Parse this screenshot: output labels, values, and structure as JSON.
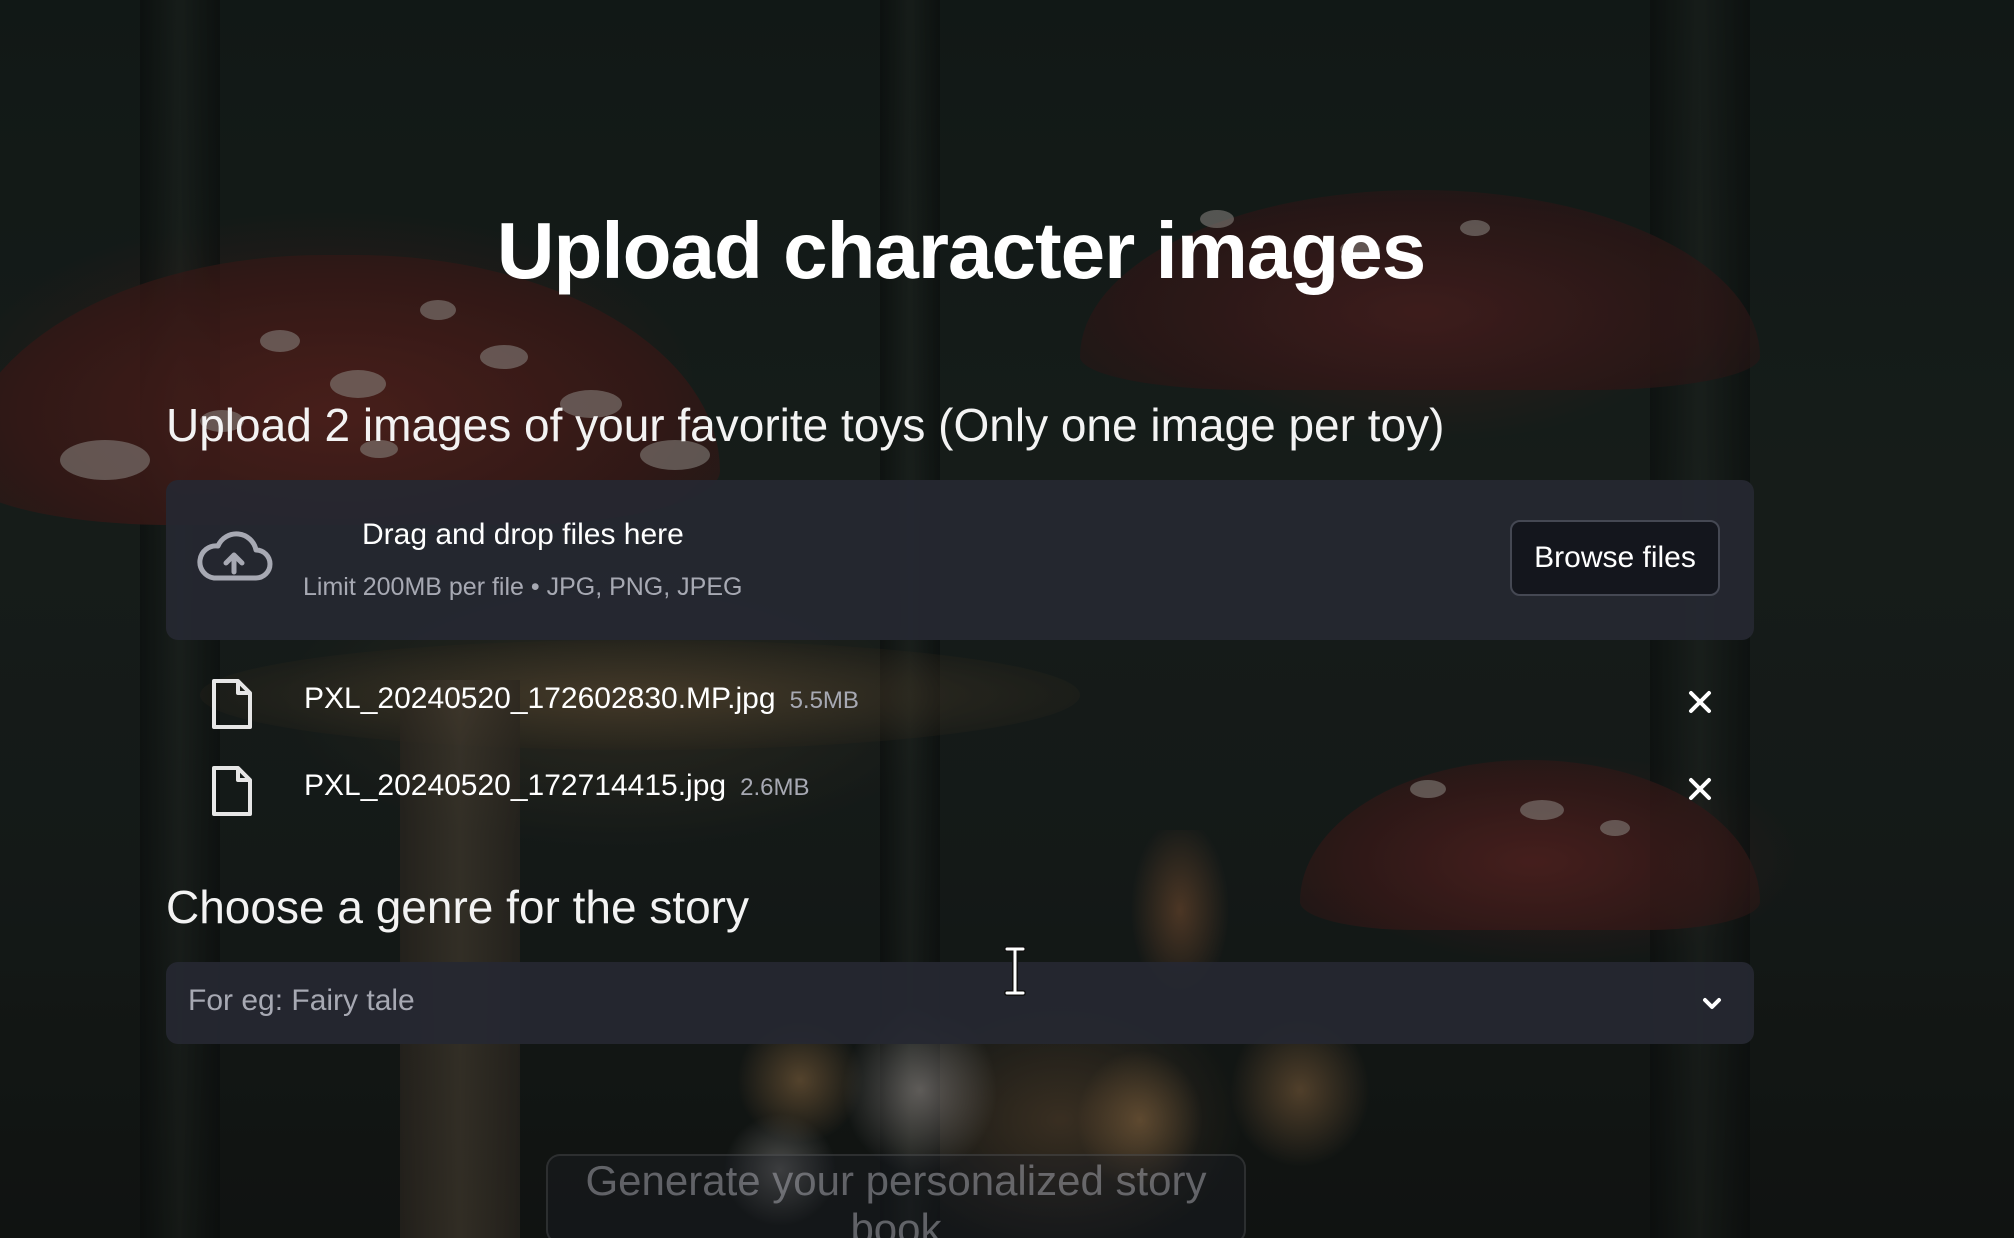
{
  "page": {
    "title": "Upload character images"
  },
  "upload": {
    "label": "Upload 2 images of your favorite toys (Only one image per toy)",
    "dropzone_title": "Drag and drop files here",
    "dropzone_limit": "Limit 200MB per file • JPG, PNG, JPEG",
    "browse_label": "Browse files",
    "files": [
      {
        "name": "PXL_20240520_172602830.MP.jpg",
        "size": "5.5MB"
      },
      {
        "name": "PXL_20240520_172714415.jpg",
        "size": "2.6MB"
      }
    ]
  },
  "genre": {
    "label": "Choose a genre for the story",
    "placeholder": "For eg: Fairy tale"
  },
  "generate": {
    "label": "Generate your personalized story book"
  },
  "colors": {
    "panel": "#262832",
    "text": "#ffffff",
    "muted": "#a7a9b3",
    "button_bg": "#14161d"
  },
  "icons": {
    "upload": "cloud-upload-icon",
    "file": "file-icon",
    "remove": "close-icon",
    "dropdown": "chevron-down-icon",
    "cursor": "text-cursor-icon"
  }
}
